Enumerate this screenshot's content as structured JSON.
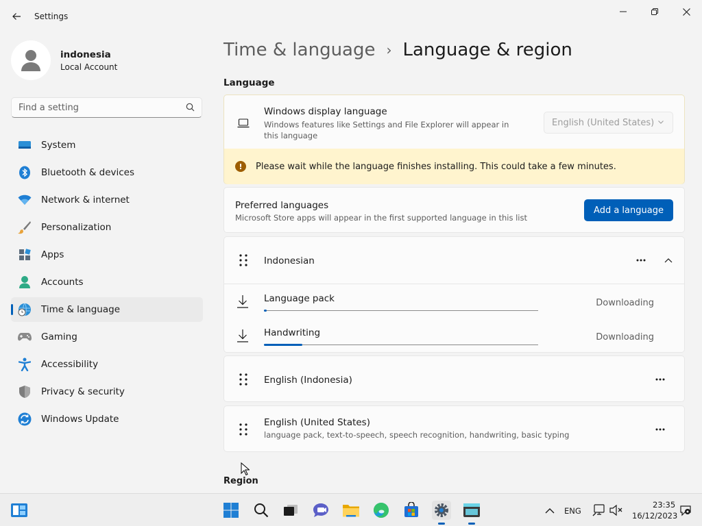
{
  "window": {
    "title": "Settings"
  },
  "profile": {
    "name": "indonesia",
    "account_type": "Local Account"
  },
  "search": {
    "placeholder": "Find a setting"
  },
  "sidebar": {
    "items": [
      {
        "label": "System",
        "icon": "monitor-icon"
      },
      {
        "label": "Bluetooth & devices",
        "icon": "bluetooth-icon"
      },
      {
        "label": "Network & internet",
        "icon": "wifi-icon"
      },
      {
        "label": "Personalization",
        "icon": "paintbrush-icon"
      },
      {
        "label": "Apps",
        "icon": "apps-icon"
      },
      {
        "label": "Accounts",
        "icon": "person-icon"
      },
      {
        "label": "Time & language",
        "icon": "globe-clock-icon",
        "selected": true
      },
      {
        "label": "Gaming",
        "icon": "gamepad-icon"
      },
      {
        "label": "Accessibility",
        "icon": "accessibility-icon"
      },
      {
        "label": "Privacy & security",
        "icon": "shield-icon"
      },
      {
        "label": "Windows Update",
        "icon": "update-icon"
      }
    ]
  },
  "breadcrumb": {
    "parent": "Time & language",
    "separator": "›",
    "current": "Language & region"
  },
  "language_section": {
    "title": "Language",
    "display_language": {
      "title": "Windows display language",
      "subtitle": "Windows features like Settings and File Explorer will appear in this language",
      "value": "English (United States)"
    },
    "warning": "Please wait while the language finishes installing. This could take a few minutes.",
    "preferred": {
      "title": "Preferred languages",
      "subtitle": "Microsoft Store apps will appear in the first supported language in this list",
      "add_button": "Add a language"
    },
    "languages": [
      {
        "name": "Indonesian",
        "expanded": true,
        "features": [
          {
            "label": "Language pack",
            "status": "Downloading",
            "progress": 0.01
          },
          {
            "label": "Handwriting",
            "status": "Downloading",
            "progress": 0.14
          }
        ]
      },
      {
        "name": "English (Indonesia)",
        "subtitle": ""
      },
      {
        "name": "English (United States)",
        "subtitle": "language pack, text-to-speech, speech recognition, handwriting, basic typing"
      }
    ]
  },
  "region_section": {
    "title": "Region"
  },
  "taskbar": {
    "input_language": "ENG",
    "time": "23:35",
    "date": "16/12/2023"
  },
  "colors": {
    "accent": "#005fb8",
    "warning_bg": "#fff4ce",
    "warning_icon": "#9d5d00"
  }
}
